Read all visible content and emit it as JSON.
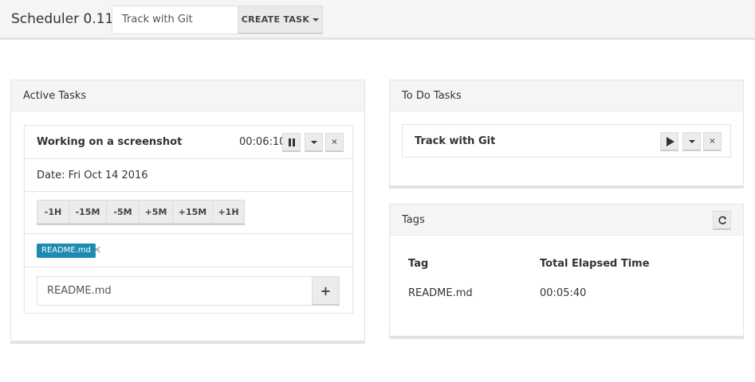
{
  "app": {
    "title": "Scheduler 0.11"
  },
  "header": {
    "task_input_value": "Track with Git",
    "create_task_label": "CREATE TASK"
  },
  "active_panel": {
    "title": "Active Tasks",
    "task": {
      "name": "Working on a screenshot",
      "elapsed": "00:06:10",
      "date": "Date: Fri Oct 14 2016",
      "adjust_buttons": [
        "-1H",
        "-15M",
        "-5M",
        "+5M",
        "+15M",
        "+1H"
      ],
      "tags": [
        "README.md"
      ],
      "tag_remove_symbol": "×",
      "tag_input_value": "README.md",
      "add_tag_symbol": "+",
      "close_symbol": "×"
    }
  },
  "todo_panel": {
    "title": "To Do Tasks",
    "task": {
      "name": "Track with Git",
      "close_symbol": "×"
    }
  },
  "tags_panel": {
    "title": "Tags",
    "columns": [
      "Tag",
      "Total Elapsed Time"
    ],
    "rows": [
      {
        "tag": "README.md",
        "time": "00:05:40"
      }
    ]
  },
  "icons": {
    "pause": "pause-icon",
    "dropdown": "caret-down-icon",
    "close": "close-icon",
    "play": "play-icon",
    "refresh": "refresh-icon",
    "add": "plus-icon"
  },
  "colors": {
    "tag_badge": "#1b8bb4",
    "header_bg": "#f5f5f5"
  }
}
